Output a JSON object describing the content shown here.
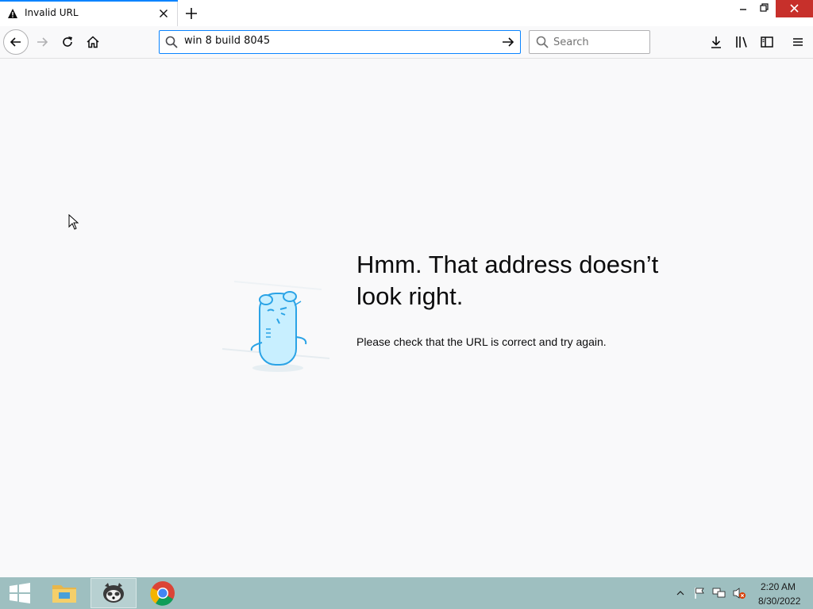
{
  "colors": {
    "accent": "#0a84ff",
    "close_button": "#c7302b",
    "taskbar": "#9ebfc0",
    "page_background": "#f9f9fa"
  },
  "tab": {
    "title": "Invalid URL",
    "icon": "warning-icon"
  },
  "window_controls": [
    "minimize-icon",
    "restore-icon",
    "close-icon"
  ],
  "toolbar": {
    "icons": [
      "back-arrow-icon",
      "forward-arrow-icon",
      "reload-icon",
      "home-icon",
      "download-icon",
      "library-icon",
      "sidebar-icon",
      "menu-icon"
    ]
  },
  "urlbar": {
    "value": "win 8 build 8045",
    "search_icon": "search-icon",
    "go_icon": "go-arrow-icon"
  },
  "searchbar": {
    "placeholder": "Search"
  },
  "error": {
    "title": "Hmm. That address doesn’t look right.",
    "description": "Please check that the URL is correct and try again.",
    "illustration": "confused-animal-illustration"
  },
  "taskbar": {
    "items": [
      "windows-start-icon",
      "file-explorer-icon",
      "firefox-icon",
      "chrome-icon"
    ],
    "tray_icons": [
      "show-hidden-icons-icon",
      "flag-icon",
      "network-icon",
      "volume-muted-icon"
    ],
    "time": "2:20 AM",
    "date": "8/30/2022"
  }
}
